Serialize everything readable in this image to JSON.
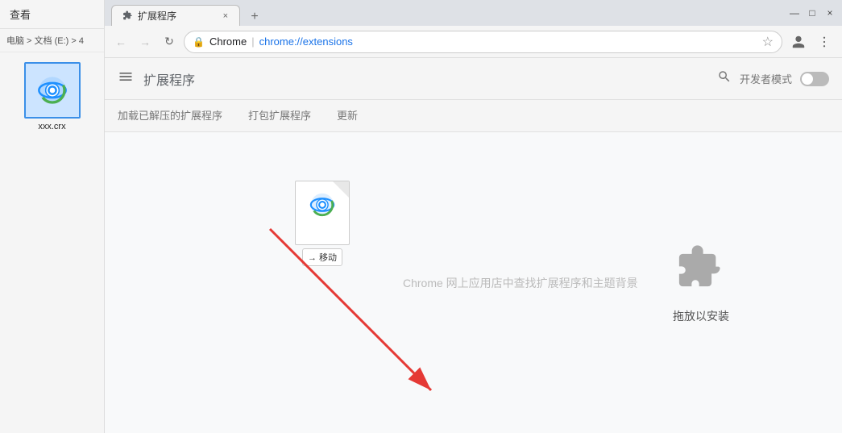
{
  "sidebar": {
    "label": "查看",
    "breadcrumb": "电脑 > 文档 (E:) > 4",
    "file": {
      "name": "xxx.crx",
      "selected": true
    }
  },
  "browser": {
    "tab": {
      "label": "扩展程序",
      "close": "×"
    },
    "tab_new": "+",
    "window_controls": {
      "minimize": "—",
      "maximize": "□",
      "close": "×"
    },
    "toolbar": {
      "back": "←",
      "forward": "→",
      "refresh": "↻",
      "address_secure": "🔒",
      "address_domain": "Chrome",
      "address_separator": " | ",
      "address_path": "chrome://extensions",
      "star": "☆",
      "account": "⊙",
      "menu": "⋮"
    },
    "ext_header": {
      "menu_icon": "≡",
      "title": "扩展程序",
      "search_icon": "🔍",
      "dev_mode_label": "开发者模式"
    },
    "subnav": {
      "items": [
        "加载已解压的扩展程序",
        "打包扩展程序",
        "更新"
      ]
    },
    "main": {
      "drag_hint": "Chrome 网上应用店中查找扩展程序和主题背景",
      "drop_label": "拖放以安装",
      "crx_move_label": "→ 移动"
    }
  }
}
